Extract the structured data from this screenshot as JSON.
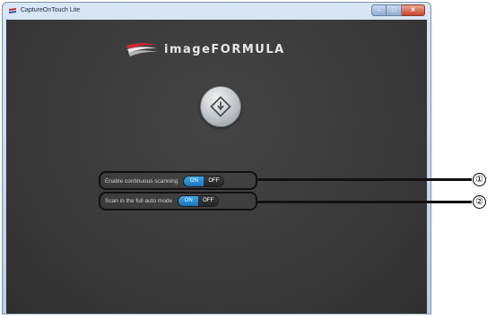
{
  "window": {
    "title": "CaptureOnTouch Lite",
    "minimize_glyph": "–",
    "maximize_glyph": "□",
    "close_glyph": "✕"
  },
  "logo": {
    "text": "imageFORMULA",
    "mark_icon": "canon-swoosh-logo"
  },
  "start_button": {
    "icon": "start-diamond-icon"
  },
  "settings": [
    {
      "label": "Enable continuous scanning",
      "on_label": "ON",
      "off_label": "OFF",
      "selected": "ON"
    },
    {
      "label": "Scan in the full auto mode",
      "on_label": "ON",
      "off_label": "OFF",
      "selected": "ON"
    }
  ],
  "callouts": [
    "①",
    "②"
  ],
  "colors": {
    "background_dark": "#3a3a3a",
    "toggle_on": "#1f8fd6",
    "toggle_off": "#2a2a2a",
    "logo_red": "#d8262f",
    "callout": "#111111"
  }
}
